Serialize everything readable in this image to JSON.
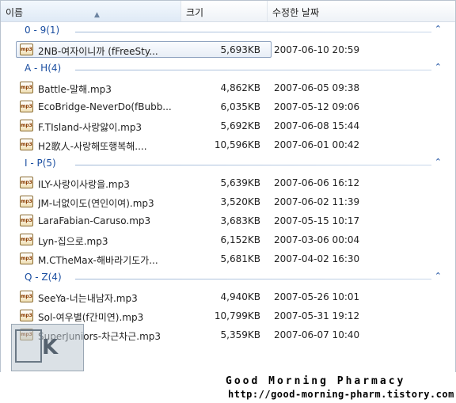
{
  "header": {
    "col_name": "이름",
    "col_size": "크기",
    "col_date": "수정한 날짜"
  },
  "groups": [
    {
      "label": "0 - 9(1)",
      "files": [
        {
          "name": "2NB-여자이니까 (fFreeSty...",
          "size": "5,693KB",
          "date": "2007-06-10 20:59",
          "selected": true
        }
      ]
    },
    {
      "label": "A - H(4)",
      "files": [
        {
          "name": "Battle-말해.mp3",
          "size": "4,862KB",
          "date": "2007-06-05 09:38"
        },
        {
          "name": "EcoBridge-NeverDo(fBubb...",
          "size": "6,035KB",
          "date": "2007-05-12 09:06"
        },
        {
          "name": "F.TIsland-사랑앓이.mp3",
          "size": "5,692KB",
          "date": "2007-06-08 15:44"
        },
        {
          "name": "H2歌人-사랑해또행복해....",
          "size": "10,596KB",
          "date": "2007-06-01 00:42"
        }
      ]
    },
    {
      "label": "I - P(5)",
      "files": [
        {
          "name": "ILY-사랑이사랑을.mp3",
          "size": "5,639KB",
          "date": "2007-06-06 16:12"
        },
        {
          "name": "JM-너없이도(연인이여).mp3",
          "size": "3,520KB",
          "date": "2007-06-02 11:39"
        },
        {
          "name": "LaraFabian-Caruso.mp3",
          "size": "3,683KB",
          "date": "2007-05-15 10:17"
        },
        {
          "name": "Lyn-집으로.mp3",
          "size": "6,152KB",
          "date": "2007-03-06 00:04"
        },
        {
          "name": "M.CTheMax-해바라기도가...",
          "size": "5,681KB",
          "date": "2007-04-02 16:30"
        }
      ]
    },
    {
      "label": "Q - Z(4)",
      "files": [
        {
          "name": "SeeYa-너는내남자.mp3",
          "size": "4,940KB",
          "date": "2007-05-26 10:01"
        },
        {
          "name": "Sol-여우별(f간미연).mp3",
          "size": "10,799KB",
          "date": "2007-05-31 19:12"
        },
        {
          "name": "SuperJuniors-차근차근.mp3",
          "size": "5,359KB",
          "date": "2007-06-07 10:40"
        }
      ]
    }
  ],
  "icon_label": "mp3",
  "watermark": {
    "line1": "Good Morning Pharmacy",
    "line2": "http://good-morning-pharm.tistory.com"
  },
  "logo_letter": "K",
  "colors": {
    "group_text": "#1c4fa1",
    "selection_border": "#8ea2bf"
  }
}
